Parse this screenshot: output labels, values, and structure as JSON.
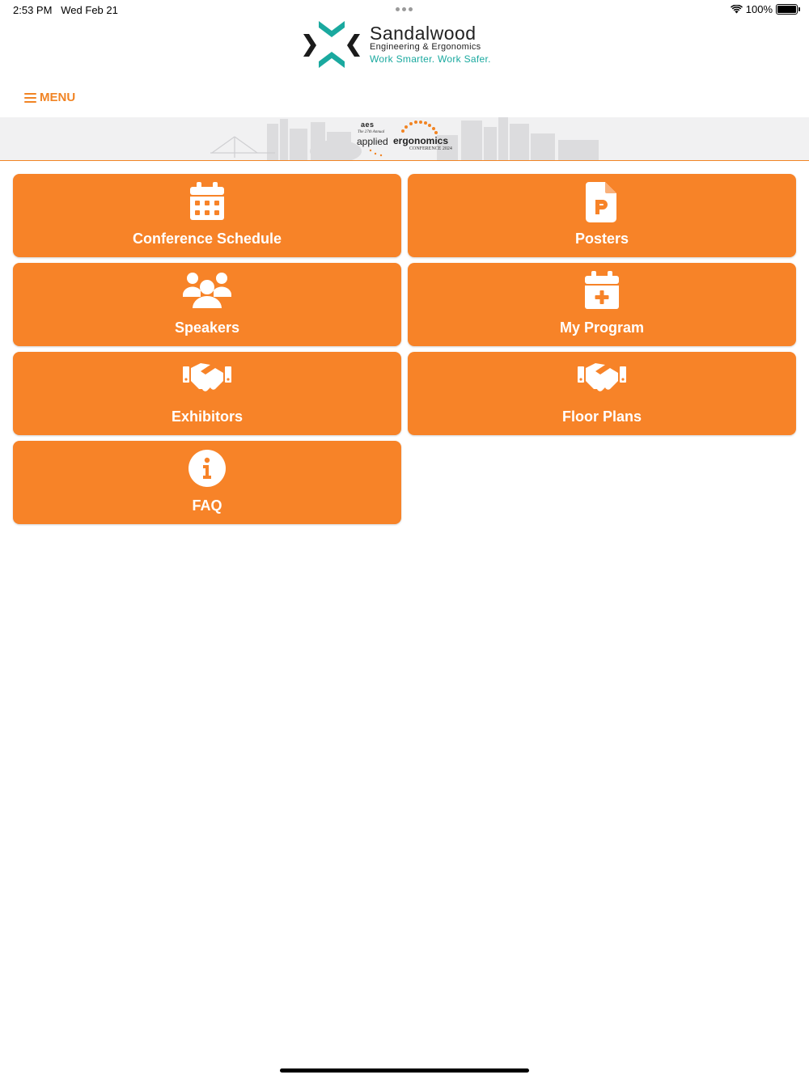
{
  "status": {
    "time": "2:53 PM",
    "date": "Wed Feb 21",
    "battery": "100%"
  },
  "header": {
    "brand_name": "Sandalwood",
    "brand_sub": "Engineering & Ergonomics",
    "brand_tagline": "Work Smarter. Work Safer.",
    "teal": "#1aa99f"
  },
  "menu": {
    "label": "MENU",
    "icon": "hamburger-icon"
  },
  "banner": {
    "org": "aes",
    "edition": "The 27th Annual",
    "title_a": "applied",
    "title_b": "ergonomics",
    "subtitle": "CONFERENCE 2024"
  },
  "tiles": [
    {
      "label": "Conference Schedule",
      "icon": "calendar-icon"
    },
    {
      "label": "Posters",
      "icon": "poster-file-icon"
    },
    {
      "label": "Speakers",
      "icon": "people-group-icon"
    },
    {
      "label": "My Program",
      "icon": "calendar-plus-icon"
    },
    {
      "label": "Exhibitors",
      "icon": "handshake-icon"
    },
    {
      "label": "Floor Plans",
      "icon": "handshake-icon"
    },
    {
      "label": "FAQ",
      "icon": "info-circle-icon"
    }
  ],
  "colors": {
    "accent": "#f78328",
    "menu_text": "#f18424"
  }
}
